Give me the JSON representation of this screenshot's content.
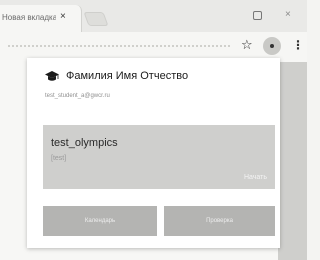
{
  "browser": {
    "tab_title": "Новая вкладка",
    "tab_close": "×",
    "minimize_glyph": "▢",
    "close_glyph": "×",
    "icons": {
      "bookmark": "star-icon",
      "extension": "extension-icon",
      "menu": "kebab-menu-icon"
    },
    "star_glyph": "☆",
    "menu_glyph": "⋮"
  },
  "popup": {
    "user_name": "Фамилия Имя Отчество",
    "user_email": "test_student_a@gwcr.ru",
    "user_icon": "graduation-cap-icon",
    "olympiad": {
      "title": "test_olympics",
      "subtitle": "[test]",
      "action": "Начать"
    },
    "buttons": {
      "calendar": "Календарь",
      "check": "Проверка"
    }
  },
  "colors": {
    "card": "#cfcfcd",
    "button": "#b4b4b2"
  }
}
